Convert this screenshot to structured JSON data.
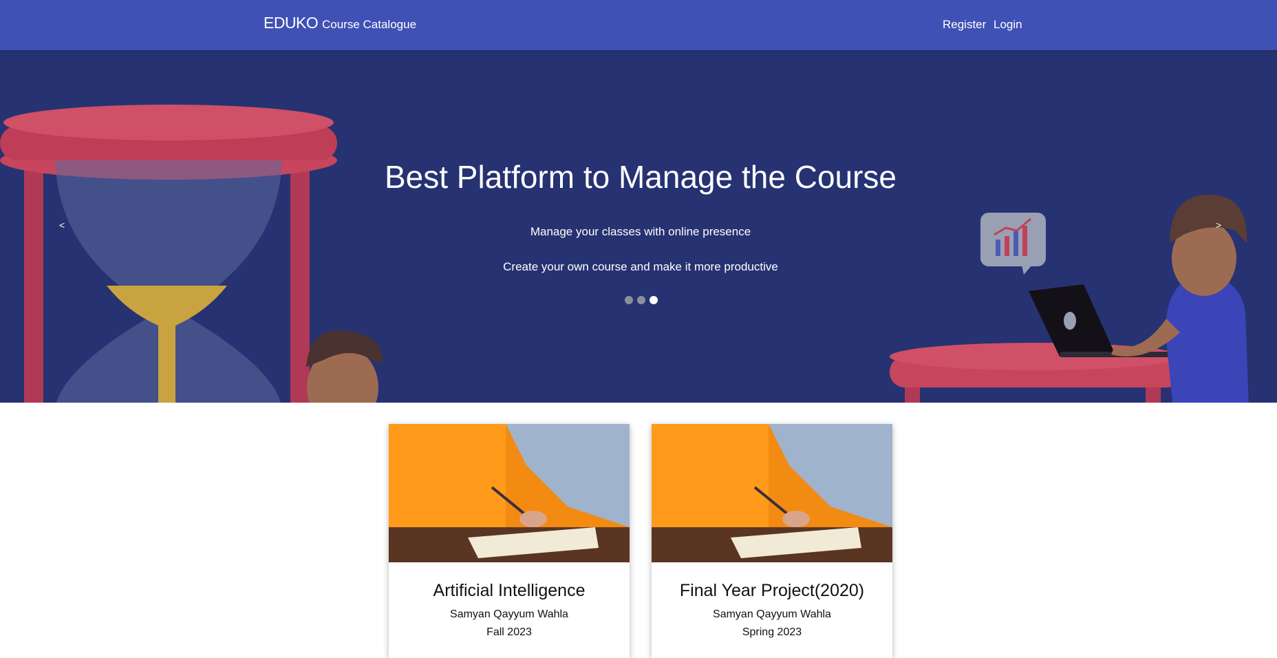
{
  "navbar": {
    "brand": "EDUKO",
    "catalogue_label": "Course Catalogue",
    "register_label": "Register",
    "login_label": "Login",
    "background": "#3f51b5"
  },
  "hero": {
    "title": "Best Platform to Manage the Course",
    "line1": "Manage your classes with online presence",
    "line2": "Create your own course and make it more productive",
    "prev_label": "<",
    "next_label": ">",
    "slides": 3,
    "active_slide": 3,
    "background": "#263271"
  },
  "courses": [
    {
      "title": "Artificial Intelligence",
      "instructor": "Samyan Qayyum Wahla",
      "term": "Fall 2023"
    },
    {
      "title": "Final Year Project(2020)",
      "instructor": "Samyan Qayyum Wahla",
      "term": "Spring 2023"
    }
  ]
}
